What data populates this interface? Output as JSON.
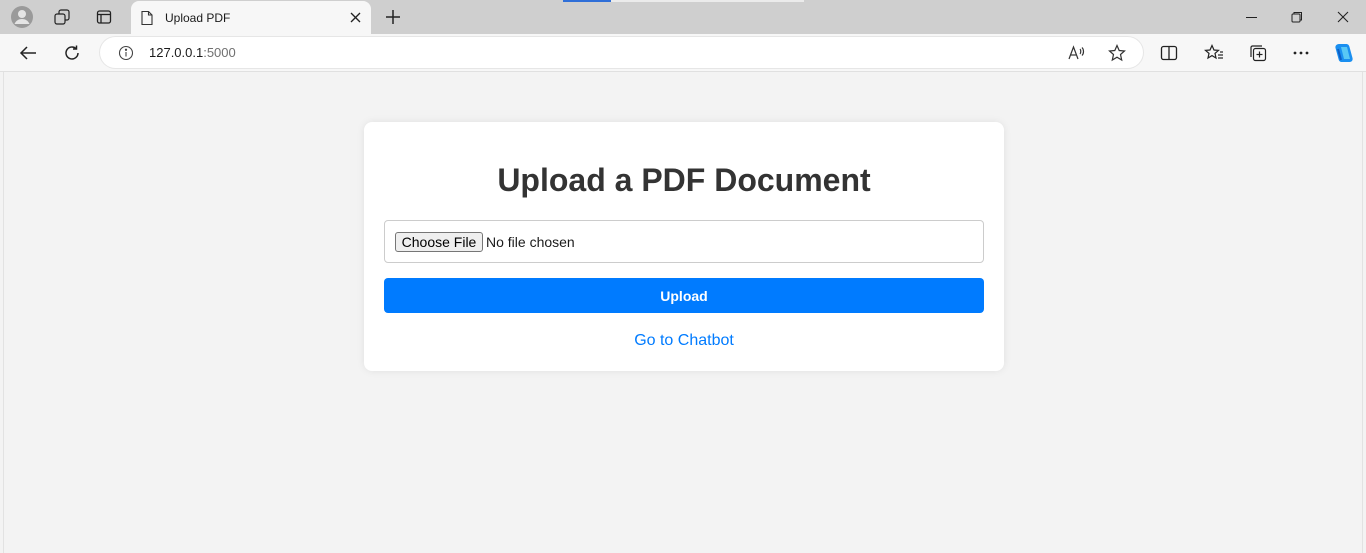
{
  "browser": {
    "tab": {
      "title": "Upload PDF"
    },
    "address_bar": {
      "host": "127.0.0.1",
      "port": ":5000"
    }
  },
  "page": {
    "heading": "Upload a PDF Document",
    "file_input": {
      "button_label": "Choose File",
      "status": "No file chosen"
    },
    "upload_button": "Upload",
    "chatbot_link": "Go to Chatbot"
  },
  "colors": {
    "primary": "#007bff",
    "heading": "#333333",
    "page_background": "#f3f3f3",
    "card_background": "#ffffff"
  }
}
